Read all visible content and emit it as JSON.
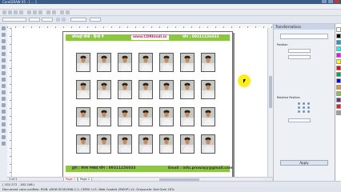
{
  "window": {
    "title": "CorelDRAW X5 - [ ... ]"
  },
  "document": {
    "header": {
      "left": "कोरलड्रॉ सीखें - हिन्दी में",
      "url": "www.CDRhindi.in",
      "right": "फोन : 09311226033"
    },
    "footer": {
      "left": "द्वारा : संजय मक्कड़ फोन : 09311226033",
      "right": "Email : info.prowayy@gmail.com"
    },
    "photo_grid": {
      "rows": 4,
      "cols": 7
    }
  },
  "page_tabs": {
    "counter": "1 of 1",
    "tabs": [
      "Page 1",
      "Page 2"
    ]
  },
  "docker": {
    "title": "Transformations",
    "position_label": "Position",
    "relative_label": "Relative Position",
    "apply_label": "Apply"
  },
  "status": {
    "coords": "( 102.272 , 182.248 )",
    "profile": "Document color profiles: RGB: sRGB IEC61966-2.1; CMYK: U.S. Web Coated (SWOP) v2; Grayscale: Dot Gain 20%"
  },
  "colors": {
    "band_green": "#8dc63f",
    "url_pink": "#d81b60",
    "cursor_yellow": "#ffeb00",
    "palette": [
      "#ffffff",
      "#000000",
      "#00a0e9",
      "#00ffff",
      "#ff00ff",
      "#ffff00",
      "#ff0000",
      "#00a650",
      "#0000ff",
      "#f7941d",
      "#8dc63f",
      "#662d91",
      "#ed1c24",
      "#a0a0a0"
    ]
  }
}
